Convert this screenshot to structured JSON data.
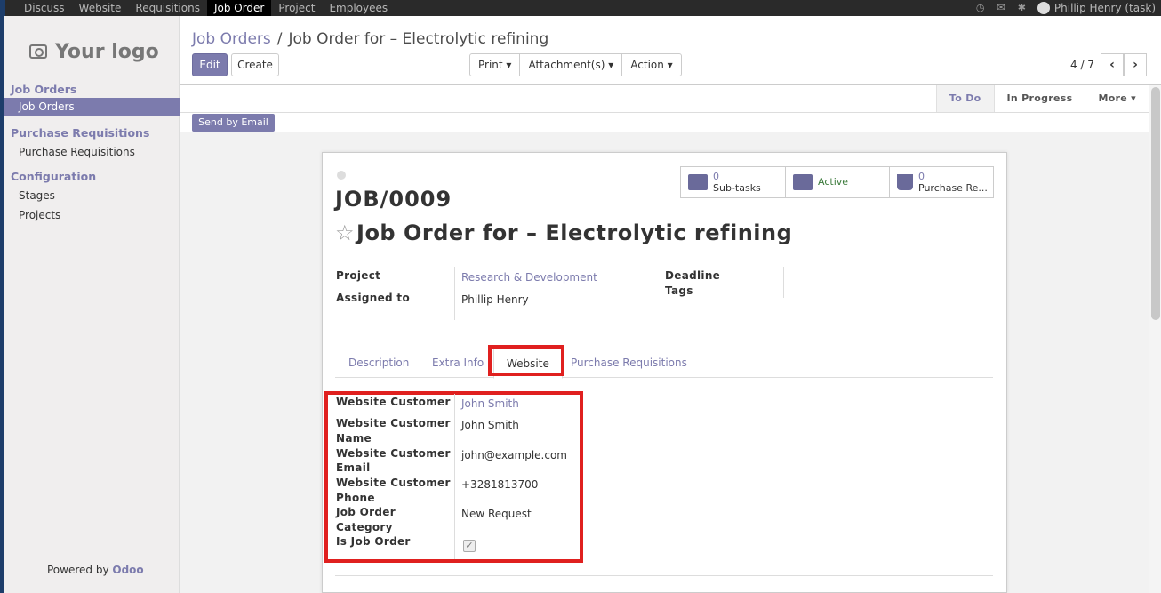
{
  "topbar": {
    "menu": [
      "Discuss",
      "Website",
      "Requisitions",
      "Job Order",
      "Project",
      "Employees"
    ],
    "active": "Job Order",
    "user": "Phillip Henry (task)"
  },
  "sidebar": {
    "logo_text": "Your logo",
    "sections": [
      {
        "title": "Job Orders",
        "items": [
          "Job Orders"
        ]
      },
      {
        "title": "Purchase Requisitions",
        "items": [
          "Purchase Requisitions"
        ]
      },
      {
        "title": "Configuration",
        "items": [
          "Stages",
          "Projects"
        ]
      }
    ],
    "powered_prefix": "Powered by",
    "powered_brand": "Odoo"
  },
  "breadcrumb": {
    "parent": "Job Orders",
    "separator": "/",
    "current": "Job Order for – Electrolytic refining"
  },
  "buttons": {
    "edit": "Edit",
    "create": "Create",
    "print": "Print ▾",
    "attachments": "Attachment(s) ▾",
    "action": "Action ▾",
    "send_email": "Send by Email"
  },
  "pager": {
    "text": "4 / 7",
    "prev": "‹",
    "next": "›"
  },
  "stages": [
    "To Do",
    "In Progress",
    "More ▾"
  ],
  "current_stage": "To Do",
  "record": {
    "name": "JOB/0009",
    "title": "Job Order for – Electrolytic refining",
    "star": "☆"
  },
  "smart_buttons": [
    {
      "number": "0",
      "label": "Sub-tasks",
      "icon": "tasks-icon"
    },
    {
      "number": "",
      "label": "Active",
      "icon": "archive-icon"
    },
    {
      "number": "0",
      "label": "Purchase Re...",
      "icon": "cart-icon"
    }
  ],
  "fields": {
    "project_label": "Project",
    "project_value": "Research & Development",
    "assigned_label": "Assigned to",
    "assigned_value": "Phillip Henry",
    "deadline_label": "Deadline",
    "tags_label": "Tags"
  },
  "tabs": [
    "Description",
    "Extra Info",
    "Website",
    "Purchase Requisitions"
  ],
  "active_tab": "Website",
  "website_fields": {
    "customer_label": "Website Customer",
    "customer_value": "John Smith",
    "name_label_1": "Website Customer",
    "name_label_2": "Name",
    "name_value": "John Smith",
    "email_label_1": "Website Customer",
    "email_label_2": "Email",
    "email_value": "john@example.com",
    "phone_label_1": "Website Customer",
    "phone_label_2": "Phone",
    "phone_value": "+3281813700",
    "category_label_1": "Job Order",
    "category_label_2": "Category",
    "category_value": "New Request",
    "is_job_order_label": "Is Job Order",
    "is_job_order_value": true
  },
  "colors": {
    "accent": "#7c7bad",
    "topbar": "#2a2a2a",
    "highlight": "#e0201f"
  }
}
